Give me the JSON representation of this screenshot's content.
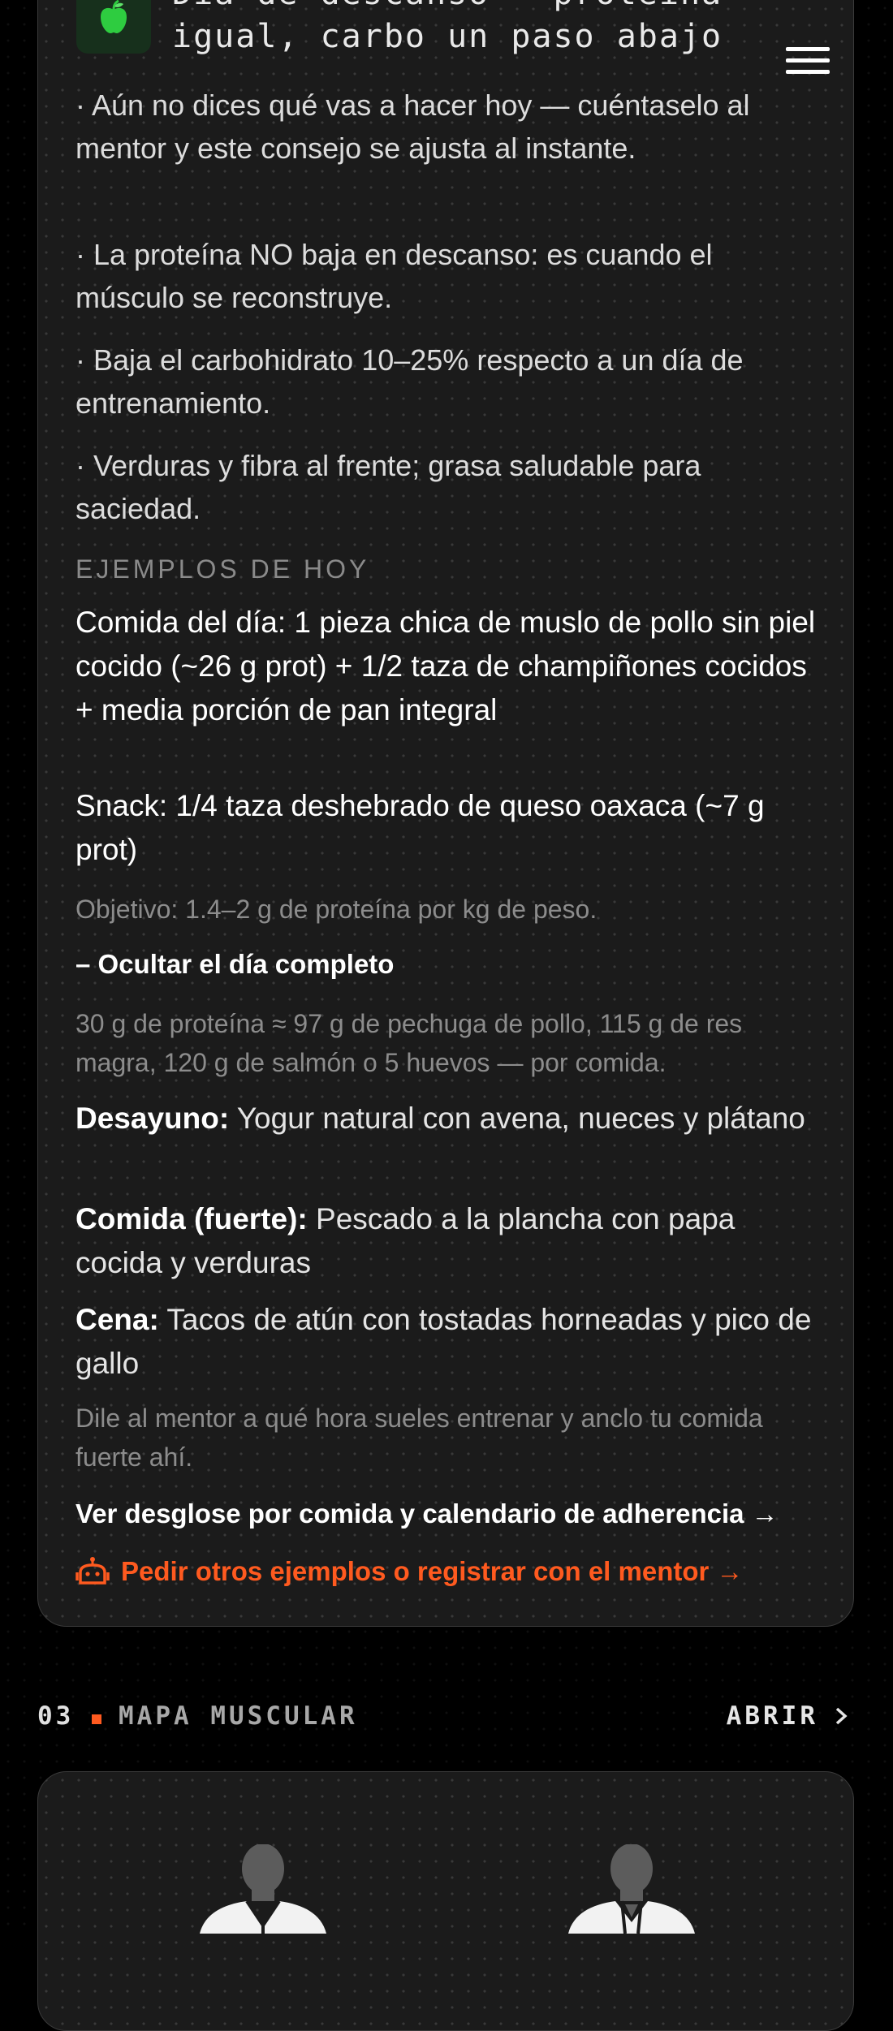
{
  "header": {
    "title_partial": "Día de descanso — proteína\nigual, carbo un paso abajo"
  },
  "tips": [
    "· Aún no dices qué vas a hacer hoy — cuéntaselo al mentor y este consejo se ajusta al instante.",
    "· La proteína NO baja en descanso: es cuando el músculo se reconstruye.",
    "· Baja el carbohidrato 10–25% respecto a un día de entrenamiento.",
    "· Verduras y fibra al frente; grasa saludable para saciedad."
  ],
  "examples": {
    "label": "EJEMPLOS DE HOY",
    "items": [
      "Comida del día: 1 pieza chica de muslo de pollo sin piel cocido (~26 g prot) + 1/2 taza de champiñones cocidos + media porción de pan integral",
      "Snack: 1/4 taza deshebrado de queso oaxaca (~7 g prot)"
    ],
    "goal": "Objetivo: 1.4–2 g de proteína por kg de peso."
  },
  "toggle_label": "– Ocultar el día completo",
  "full_day": {
    "protein_note": "30 g de proteína ≈ 97 g de pechuga de pollo, 115 g de res magra, 120 g de salmón o 5 huevos — por comida.",
    "meals": [
      {
        "name": "Desayuno:",
        "desc": " Yogur natural con avena, nueces y plátano"
      },
      {
        "name": "Comida (fuerte):",
        "desc": " Pescado a la plancha con papa cocida y verduras"
      },
      {
        "name": "Cena:",
        "desc": " Tacos de atún con tostadas horneadas y pico de gallo"
      }
    ],
    "mentor_hint": "Dile al mentor a qué hora sueles entrenar y anclo tu comida fuerte ahí."
  },
  "links": {
    "breakdown": "Ver desglose por comida y calendario de adherencia →",
    "ask_mentor": "Pedir otros ejemplos o registrar con el mentor →"
  },
  "section": {
    "number": "03",
    "title": "MAPA MUSCULAR",
    "action": "ABRIR"
  },
  "colors": {
    "accent": "#ff5a1f",
    "card_bg": "#1b1b1b",
    "icon_green": "#2ecc40"
  },
  "icons": {
    "app": "apple-icon",
    "menu": "hamburger-menu-icon",
    "mentor": "robot-icon",
    "open": "chevron-right-icon"
  }
}
